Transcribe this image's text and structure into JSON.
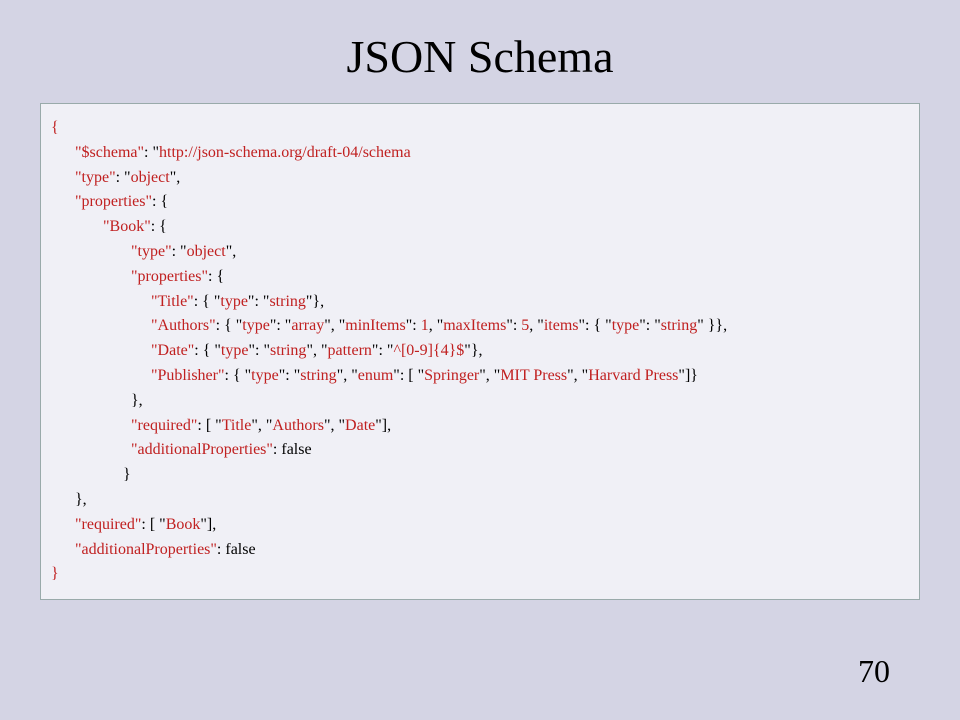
{
  "title": "JSON Schema",
  "page_number": "70",
  "code": {
    "l0": "{",
    "l1a": "\"$schema\"",
    "l1b": ": \"",
    "l1c": "http://json-schema.org/draft-04/schema",
    "l2a": "\"type\"",
    "l2b": ": \"",
    "l2c": "object",
    "l2d": "\",",
    "l3a": "\"properties\"",
    "l3b": ": {",
    "l4a": "\"Book\"",
    "l4b": ": {",
    "l5a": "\"type\"",
    "l5b": ": \"",
    "l5c": "object",
    "l5d": "\",",
    "l6a": "\"properties\"",
    "l6b": ": {",
    "l7a": "\"Title\"",
    "l7b": ": { \"",
    "l7c": "type",
    "l7d": "\": \"",
    "l7e": "string",
    "l7f": "\"},",
    "l8a": "\"Authors\"",
    "l8b": ": { \"",
    "l8c": "type",
    "l8d": "\": \"",
    "l8e": "array",
    "l8f": "\", \"",
    "l8g": "minItems",
    "l8h": "\": ",
    "l8i": "1",
    "l8j": ", \"",
    "l8k": "maxItems",
    "l8l": "\": ",
    "l8m": "5",
    "l8n": ", \"",
    "l8o": "items",
    "l8p": "\": { \"",
    "l8q": "type",
    "l8r": "\": \"",
    "l8s": "string",
    "l8t": "\" }},",
    "l9a": "\"Date\"",
    "l9b": ": { \"",
    "l9c": "type",
    "l9d": "\": \"",
    "l9e": "string",
    "l9f": "\", \"",
    "l9g": "pattern",
    "l9h": "\": \"",
    "l9i": "^[0-9]{4}$",
    "l9j": "\"},",
    "l10a": "\"Publisher\"",
    "l10b": ": { \"",
    "l10c": "type",
    "l10d": "\": \"",
    "l10e": "string",
    "l10f": "\", \"",
    "l10g": "enum",
    "l10h": "\": [ \"",
    "l10i": "Springer",
    "l10j": "\", \"",
    "l10k": "MIT Press",
    "l10l": "\", \"",
    "l10m": "Harvard Press",
    "l10n": "\"]}",
    "l11": "},",
    "l12a": "\"required\"",
    "l12b": ": [ \"",
    "l12c": "Title",
    "l12d": "\", \"",
    "l12e": "Authors",
    "l12f": "\", \"",
    "l12g": "Date",
    "l12h": "\"],",
    "l13a": "\"additionalProperties\"",
    "l13b": ": false",
    "l14": "}",
    "l15": "},",
    "l16a": "\"required\"",
    "l16b": ": [ \"",
    "l16c": "Book",
    "l16d": "\"],",
    "l17a": "\"additionalProperties\"",
    "l17b": ": false",
    "l18": "}"
  }
}
